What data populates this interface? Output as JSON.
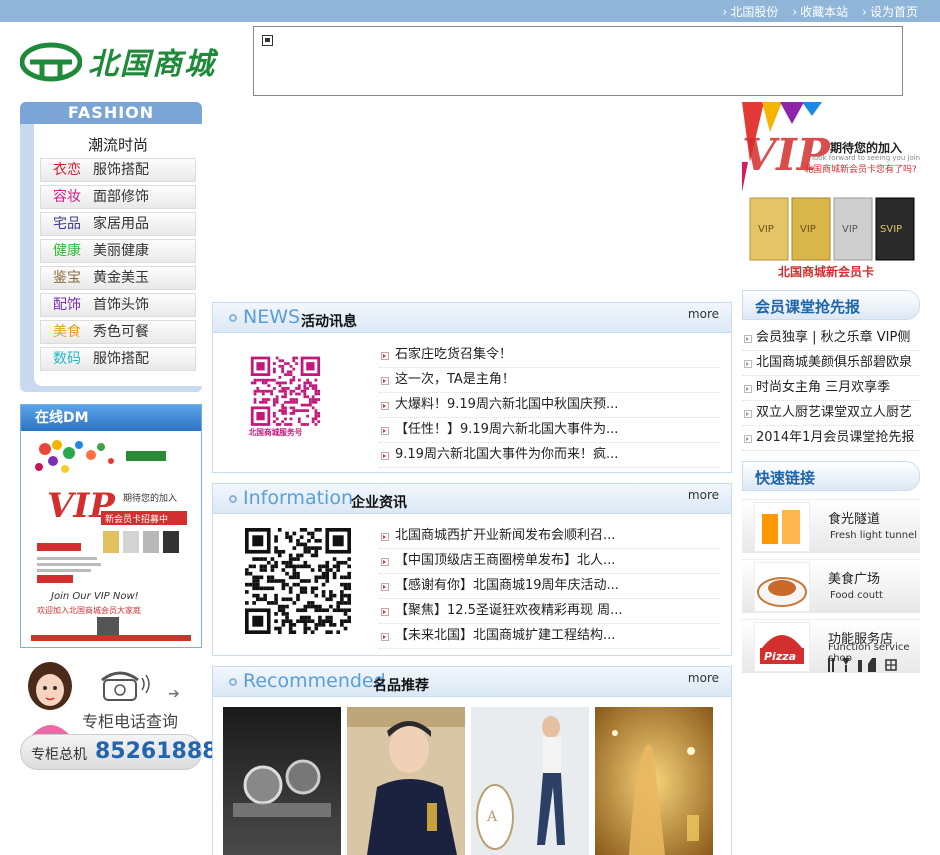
{
  "topbar": {
    "links": [
      "北国股份",
      "收藏本站",
      "设为首页"
    ]
  },
  "logo": {
    "text": "北国商城"
  },
  "fashion": {
    "header": "FASHION",
    "subtitle": "潮流时尚",
    "items": [
      {
        "key": "衣恋",
        "value": "服饰搭配",
        "color": "#d0202e"
      },
      {
        "key": "容妆",
        "value": "面部修饰",
        "color": "#d0208a"
      },
      {
        "key": "宅品",
        "value": "家居用品",
        "color": "#3d3d8f"
      },
      {
        "key": "健康",
        "value": "美丽健康",
        "color": "#33bb33"
      },
      {
        "key": "鉴宝",
        "value": "黄金美玉",
        "color": "#8a6a3a"
      },
      {
        "key": "配饰",
        "value": "首饰头饰",
        "color": "#7b2fb5"
      },
      {
        "key": "美食",
        "value": "秀色可餐",
        "color": "#e0a020"
      },
      {
        "key": "数码",
        "value": "服饰搭配",
        "color": "#22b8c8"
      }
    ]
  },
  "dm": {
    "header": "在线DM",
    "poster_lines": [
      "期待您的加入",
      "VIP",
      "新会员卡招募中",
      "Join Our VIP Now!",
      "欢迎加入北国商城会员大家庭"
    ]
  },
  "phone": {
    "query": "专柜电话查询",
    "label": "专柜总机",
    "number": "85261888"
  },
  "news": {
    "en": "NEWS",
    "cn": "活动讯息",
    "more": "more",
    "qr_caption": "北国商城服务号",
    "items": [
      "石家庄吃货召集令！",
      "这一次，TA是主角！",
      "大爆料！9.19周六新北国中秋国庆预...",
      "【任性！】9.19周六新北国大事件为...",
      "9.19周六新北国大事件为你而来！疯..."
    ]
  },
  "info": {
    "en": "Information",
    "cn": "企业资讯",
    "more": "more",
    "items": [
      "北国商城西扩开业新闻发布会顺利召...",
      "【中国顶级店王商圈榜单发布】北人...",
      "【感谢有你】北国商城19周年庆活动...",
      "【聚焦】12.5圣诞狂欢夜精彩再现  周...",
      "【未来北国】北国商城扩建工程结构..."
    ]
  },
  "recommended": {
    "en": "Recommended",
    "cn": "名品推荐",
    "more": "more"
  },
  "vip": {
    "tagline": "期待您的加入",
    "tagline_en": "look forward to seeing you join",
    "question": "北国商城新会员卡您有了吗?",
    "cards": [
      "VIP",
      "VIP",
      "VIP",
      "SVIP"
    ],
    "caption": "北国商城新会员卡"
  },
  "member": {
    "header": "会员课堂抢先报",
    "items": [
      "会员独享 | 秋之乐章  VIP侧",
      "北国商城美颜俱乐部碧欧泉",
      "时尚女主角  三月欢享季",
      "双立人厨艺课堂双立人厨艺",
      "2014年1月会员课堂抢先报"
    ]
  },
  "quicklinks": {
    "header": "快速链接",
    "items": [
      {
        "cn": "食光隧道",
        "en": "Fresh light tunnel"
      },
      {
        "cn": "美食广场",
        "en": "Food  coutt"
      },
      {
        "cn": "功能服务店",
        "en": "Function service shop"
      }
    ]
  }
}
